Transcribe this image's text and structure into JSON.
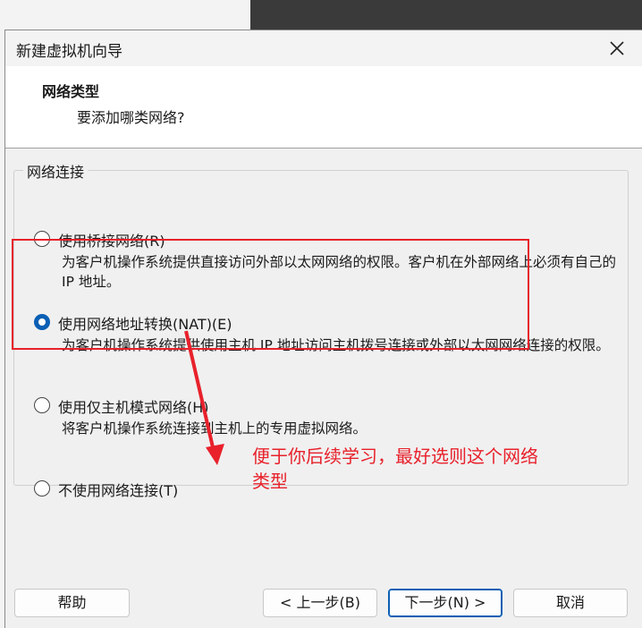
{
  "window": {
    "title": "新建虚拟机向导"
  },
  "header": {
    "title": "网络类型",
    "subtitle": "要添加哪类网络?"
  },
  "group": {
    "label": "网络连接"
  },
  "options": [
    {
      "label": "使用桥接网络(R)",
      "description": "为客户机操作系统提供直接访问外部以太网网络的权限。客户机在外部网络上必须有自己的 IP 地址。",
      "checked": false
    },
    {
      "label": "使用网络地址转换(NAT)(E)",
      "description": "为客户机操作系统提供使用主机 IP 地址访问主机拨号连接或外部以太网网络连接的权限。",
      "checked": true
    },
    {
      "label": "使用仅主机模式网络(H)",
      "description": "将客户机操作系统连接到主机上的专用虚拟网络。",
      "checked": false
    },
    {
      "label": "不使用网络连接(T)",
      "description": "",
      "checked": false
    }
  ],
  "annotation": {
    "text": "便于你后续学习，最好选则这个网络类型",
    "color": "#e8212b"
  },
  "buttons": {
    "help": "帮助",
    "back": "< 上一步(B)",
    "next": "下一步(N) >",
    "cancel": "取消"
  }
}
